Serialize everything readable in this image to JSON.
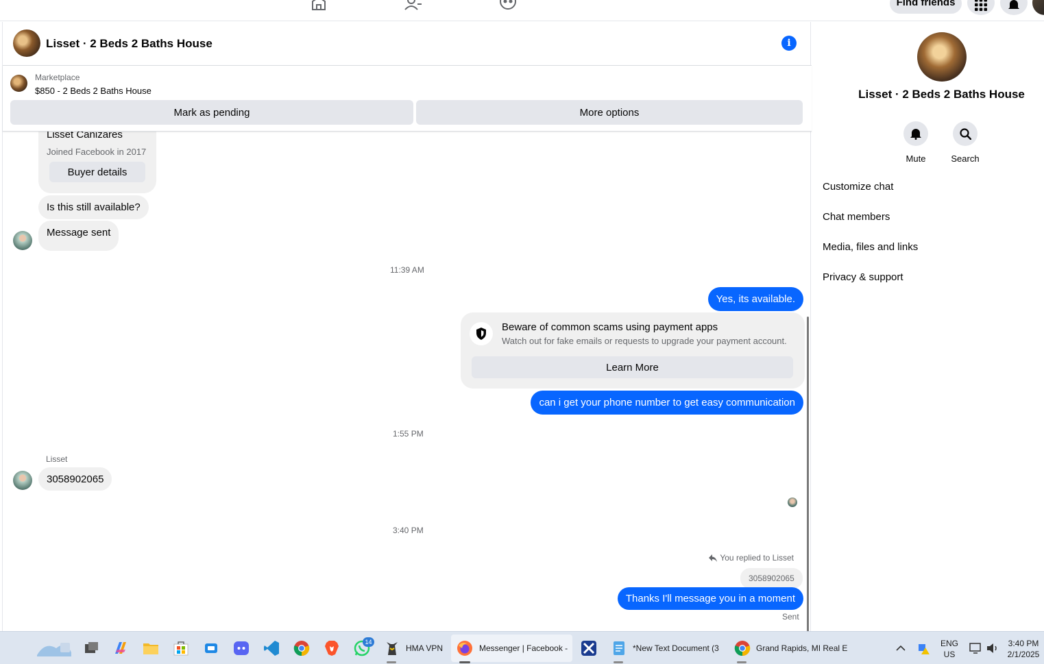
{
  "topnav": {
    "find_friends_label": "Find friends",
    "icons": [
      "home-icon",
      "friends-icon",
      "groups-icon",
      "apps-grid-icon",
      "bell-icon"
    ]
  },
  "chat": {
    "header_title": "Lisset · 2 Beds 2 Baths House",
    "marketplace": {
      "label": "Marketplace",
      "item": "$850 - 2 Beds 2 Baths House",
      "mark_pending_label": "Mark as pending",
      "more_options_label": "More options"
    },
    "buyer": {
      "name": "Lisset Cañizares",
      "joined": "Joined Facebook in 2017",
      "details_label": "Buyer details"
    },
    "messages": {
      "m1": "Is this still available?",
      "m2": "Message sent",
      "t1": "11:39 AM",
      "m3": "Yes, its available.",
      "scam_title": "Beware of common scams using payment apps",
      "scam_desc": "Watch out for fake emails or requests to upgrade your payment account.",
      "learn_more_label": "Learn More",
      "m4": "can i get your phone number to get easy communication",
      "t2": "1:55 PM",
      "sender": "Lisset",
      "m5": "3058902065",
      "t3": "3:40 PM",
      "reply_note": "You replied to Lisset",
      "reply_quote": "3058902065",
      "m6": "Thanks I'll message you in a moment",
      "sent": "Sent"
    }
  },
  "right_panel": {
    "title": "Lisset · 2 Beds 2 Baths House",
    "mute_label": "Mute",
    "search_label": "Search",
    "menu": [
      "Customize chat",
      "Chat members",
      "Media, files and links",
      "Privacy & support"
    ]
  },
  "taskbar": {
    "hma_label": "HMA VPN",
    "messenger_label": "Messenger | Facebook -",
    "notepad_label": "*New Text Document (3",
    "chrome_label": "Grand Rapids, MI Real E",
    "whatsapp_badge": "14",
    "lang": "ENG",
    "region": "US",
    "time": "3:40 PM",
    "date": "2/1/2025"
  },
  "colors": {
    "accent": "#0866ff",
    "bubble_in": "#f0f0f0",
    "button_bg": "#e4e6eb",
    "secondary_text": "#65676b"
  }
}
